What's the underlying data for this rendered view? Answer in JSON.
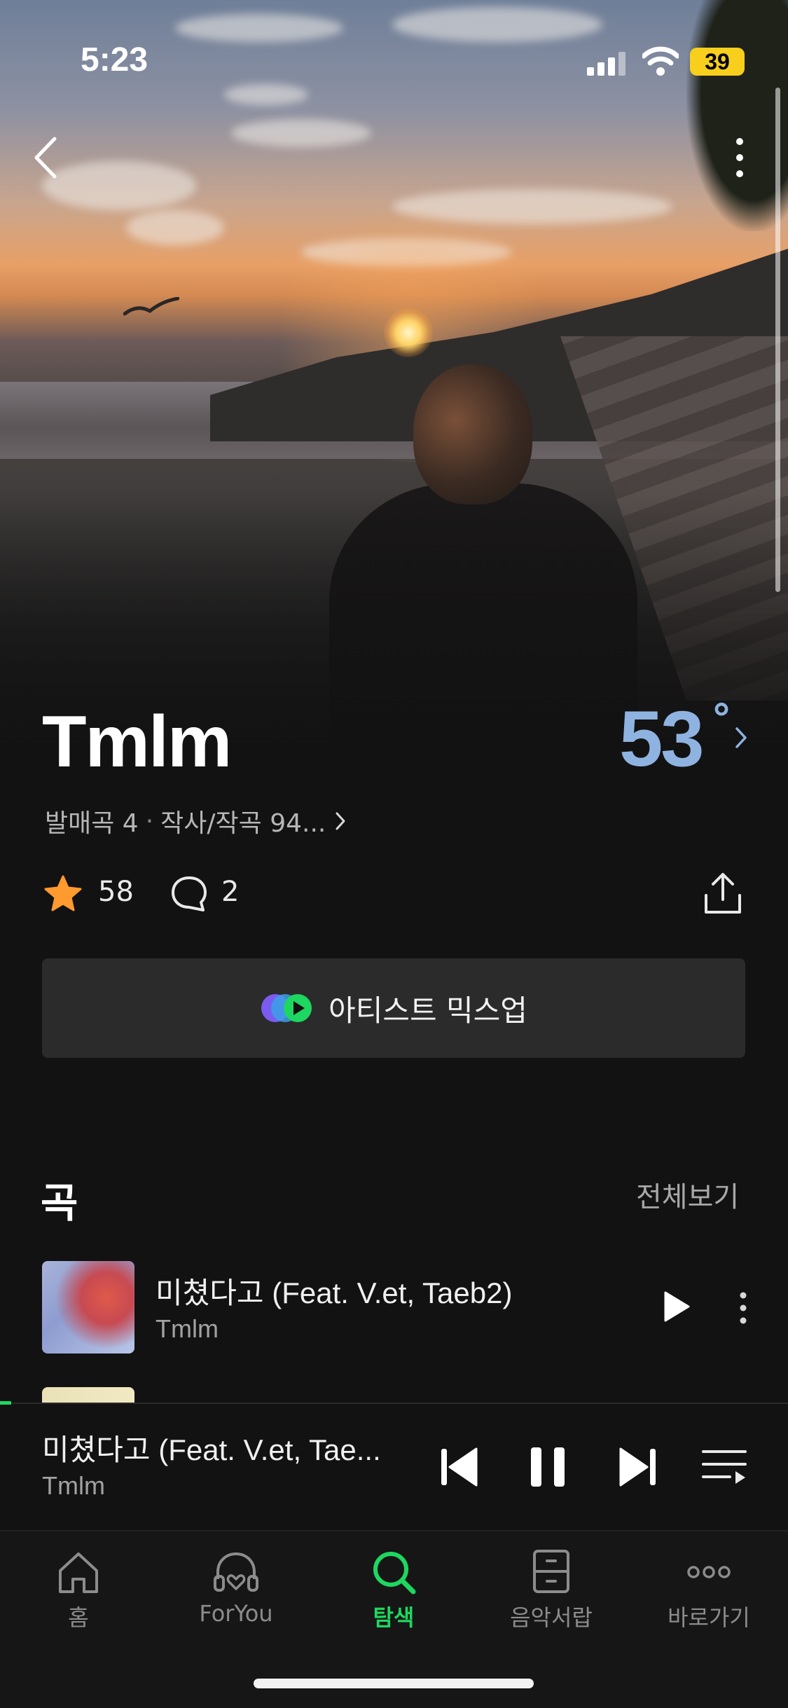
{
  "status_bar": {
    "time": "5:23",
    "battery": "39"
  },
  "artist": {
    "name": "Tmlm",
    "temperature": "53",
    "temperature_unit": "°",
    "meta_releases": "발매곡 4",
    "meta_credits": "작사/작곡 94...",
    "likes": "58",
    "comments": "2"
  },
  "mixup": {
    "label": "아티스트 믹스업"
  },
  "songs_section": {
    "title": "곡",
    "see_all": "전체보기",
    "items": [
      {
        "title": "미쳤다고 (Feat. V.et, Taeb2)",
        "artist": "Tmlm"
      }
    ]
  },
  "now_playing": {
    "title": "미쳤다고 (Feat. V.et, Tae...",
    "artist": "Tmlm",
    "progress": 0.01
  },
  "tabs": [
    {
      "label": "홈",
      "icon": "home-icon",
      "active": false
    },
    {
      "label": "ForYou",
      "icon": "headphones-heart-icon",
      "active": false
    },
    {
      "label": "탐색",
      "icon": "search-icon",
      "active": true
    },
    {
      "label": "음악서랍",
      "icon": "drawer-icon",
      "active": false
    },
    {
      "label": "바로가기",
      "icon": "more-dots-icon",
      "active": false
    }
  ],
  "colors": {
    "accent": "#1ed760",
    "temperature": "#8fb3e0",
    "star": "#ff9a2e",
    "battery": "#f7cf1c"
  }
}
